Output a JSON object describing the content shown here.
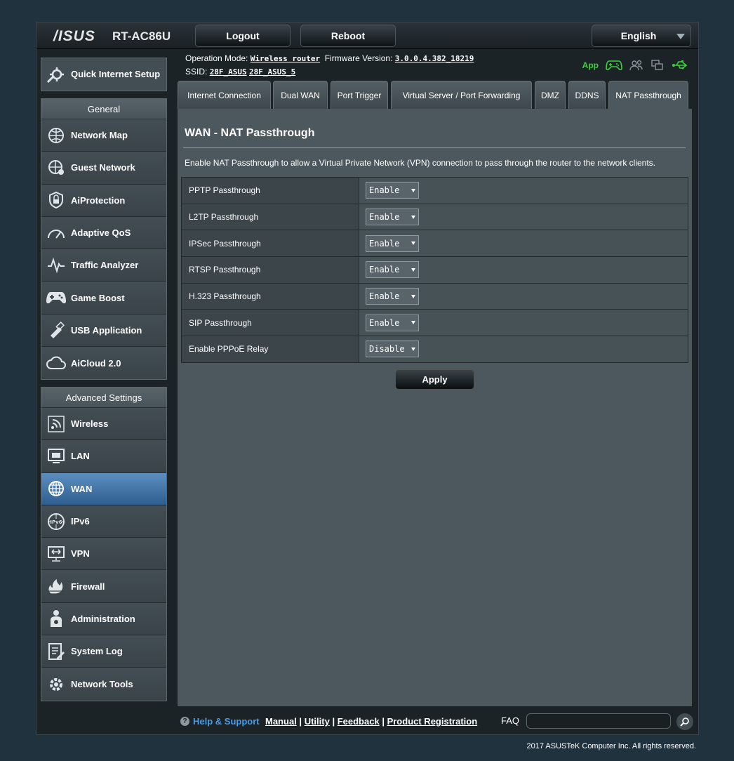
{
  "header": {
    "brand": "/ISUS",
    "model": "RT-AC86U",
    "logout": "Logout",
    "reboot": "Reboot",
    "language": "English"
  },
  "status": {
    "op_mode_label": "Operation Mode:",
    "op_mode_value": "Wireless router",
    "fw_label": "Firmware Version:",
    "fw_value": "3.0.0.4.382_18219",
    "ssid_label": "SSID:",
    "ssid_1": "28F_ASUS",
    "ssid_2": "28F_ASUS_5",
    "app_label": "App"
  },
  "sidebar": {
    "qis": "Quick Internet Setup",
    "general_head": "General",
    "general": [
      {
        "label": "Network Map",
        "icon": "network-map-icon"
      },
      {
        "label": "Guest Network",
        "icon": "guest-network-icon"
      },
      {
        "label": "AiProtection",
        "icon": "aiprotection-icon"
      },
      {
        "label": "Adaptive QoS",
        "icon": "qos-gauge-icon"
      },
      {
        "label": "Traffic Analyzer",
        "icon": "traffic-analyzer-icon"
      },
      {
        "label": "Game Boost",
        "icon": "gamepad-icon"
      },
      {
        "label": "USB Application",
        "icon": "usb-icon"
      },
      {
        "label": "AiCloud 2.0",
        "icon": "cloud-icon"
      }
    ],
    "advanced_head": "Advanced Settings",
    "advanced": [
      {
        "label": "Wireless",
        "icon": "wireless-icon"
      },
      {
        "label": "LAN",
        "icon": "lan-icon"
      },
      {
        "label": "WAN",
        "icon": "wan-globe-icon",
        "active": true
      },
      {
        "label": "IPv6",
        "icon": "ipv6-icon"
      },
      {
        "label": "VPN",
        "icon": "vpn-icon"
      },
      {
        "label": "Firewall",
        "icon": "firewall-icon"
      },
      {
        "label": "Administration",
        "icon": "administration-icon"
      },
      {
        "label": "System Log",
        "icon": "system-log-icon"
      },
      {
        "label": "Network Tools",
        "icon": "network-tools-icon"
      }
    ]
  },
  "tabs": [
    {
      "label": "Internet Connection"
    },
    {
      "label": "Dual WAN"
    },
    {
      "label": "Port Trigger"
    },
    {
      "label": "Virtual Server / Port Forwarding"
    },
    {
      "label": "DMZ"
    },
    {
      "label": "DDNS"
    },
    {
      "label": "NAT Passthrough",
      "active": true
    }
  ],
  "page": {
    "title": "WAN - NAT Passthrough",
    "description": "Enable NAT Passthrough to allow a Virtual Private Network (VPN) connection to pass through the router to the network clients.",
    "rows": [
      {
        "label": "PPTP Passthrough",
        "value": "Enable"
      },
      {
        "label": "L2TP Passthrough",
        "value": "Enable"
      },
      {
        "label": "IPSec Passthrough",
        "value": "Enable"
      },
      {
        "label": "RTSP Passthrough",
        "value": "Enable"
      },
      {
        "label": "H.323 Passthrough",
        "value": "Enable"
      },
      {
        "label": "SIP Passthrough",
        "value": "Enable"
      },
      {
        "label": "Enable PPPoE Relay",
        "value": "Disable"
      }
    ],
    "apply": "Apply"
  },
  "footer": {
    "help": "Help & Support",
    "manual": "Manual",
    "utility": "Utility",
    "feedback": "Feedback",
    "product_registration": "Product Registration",
    "sep": "|",
    "faq": "FAQ",
    "copyright": "2017 ASUSTeK Computer Inc. All rights reserved."
  },
  "colors": {
    "page_bg": "#21323f",
    "active_menu": "#3f73a6",
    "app_green": "#3cd03c",
    "help_blue": "#469df0"
  }
}
